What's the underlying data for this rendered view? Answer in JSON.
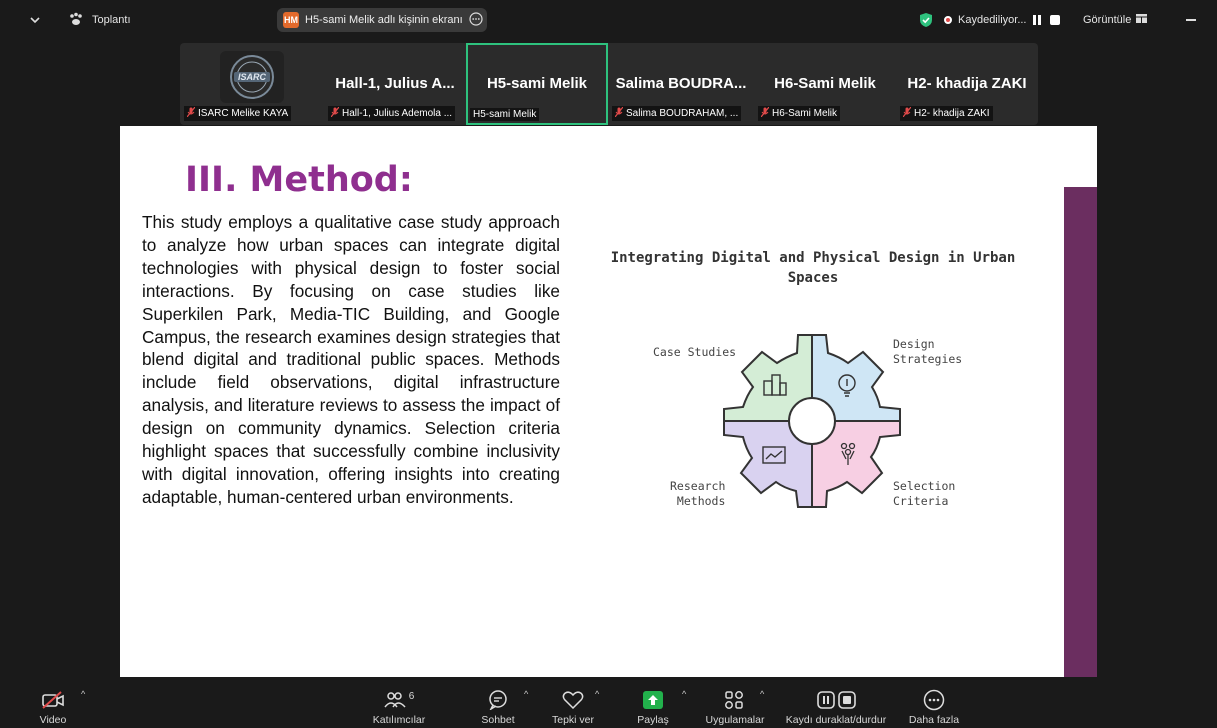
{
  "topbar": {
    "meeting_label": "Toplantı",
    "share_avatar": "HM",
    "share_text": "H5-sami Melik adlı kişinin ekranı",
    "recording_text": "Kaydediliyor...",
    "view_label": "Görüntüle"
  },
  "participants": [
    {
      "title": "",
      "label": "ISARC Melike KAYA",
      "has_logo": true
    },
    {
      "title": "Hall-1, Julius A...",
      "label": "Hall-1, Julius Ademola ..."
    },
    {
      "title": "H5-sami Melik",
      "label": "H5-sami Melik",
      "active": true
    },
    {
      "title": "Salima  BOUDRA...",
      "label": "Salima BOUDRAHAM, ..."
    },
    {
      "title": "H6-Sami Melik",
      "label": "H6-Sami Melik"
    },
    {
      "title": "H2- khadija ZAKI",
      "label": "H2- khadija ZAKI"
    }
  ],
  "logo_text": "ISARC",
  "slide": {
    "title": "III. Method:",
    "body": "This study employs a qualitative case study approach to analyze how urban spaces can integrate digital technologies with physical design to foster social interactions. By focusing on case studies like Superkilen Park, Media-TIC Building, and Google Campus, the research examines design strategies that blend digital and traditional public spaces. Methods include field observations, digital infrastructure analysis, and literature reviews to assess the impact of design on community dynamics. Selection criteria highlight spaces that successfully combine inclusivity with digital innovation, offering insights into creating adaptable, human-centered urban environments.",
    "diagram_title": "Integrating Digital and Physical Design in Urban Spaces",
    "diagram_labels": {
      "top_left": "Case Studies",
      "top_right": "Design\nStrategies",
      "bottom_left": "Research\nMethods",
      "bottom_right": "Selection\nCriteria"
    },
    "quadrant_colors": {
      "top_left": "#d4edd6",
      "top_right": "#cfe6f5",
      "bottom_left": "#d9d2f0",
      "bottom_right": "#f7cfe3"
    },
    "accent_color": "#6b2e60",
    "title_color": "#8f2f8f"
  },
  "toolbar": {
    "video": "Video",
    "participants": "Katılımcılar",
    "participant_count": "6",
    "chat": "Sohbet",
    "reactions": "Tepki ver",
    "share": "Paylaş",
    "apps": "Uygulamalar",
    "record": "Kaydı duraklat/durdur",
    "more": "Daha fazla"
  },
  "colors": {
    "active_tile_border": "#2ec27e",
    "share_green": "#22b14c",
    "mic_off_red": "#e04a4a",
    "shield_green": "#2ec27e"
  }
}
